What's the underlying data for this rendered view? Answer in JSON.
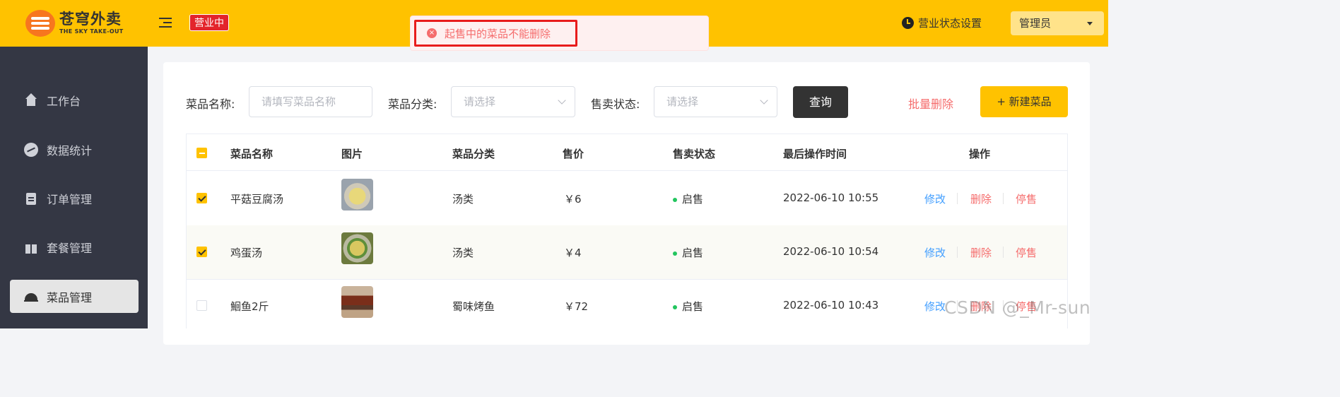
{
  "header": {
    "logo_cn": "苍穹外卖",
    "logo_en": "THE SKY TAKE-OUT",
    "status_tag": "营业中",
    "settings_label": "营业状态设置",
    "admin_label": "管理员"
  },
  "toast": {
    "message": "起售中的菜品不能删除",
    "icon": "error-icon"
  },
  "sidebar": {
    "items": [
      {
        "label": "工作台",
        "icon": "home-icon"
      },
      {
        "label": "数据统计",
        "icon": "chart-icon"
      },
      {
        "label": "订单管理",
        "icon": "clipboard-icon"
      },
      {
        "label": "套餐管理",
        "icon": "gift-icon"
      },
      {
        "label": "菜品管理",
        "icon": "cloche-icon",
        "active": true
      }
    ]
  },
  "filters": {
    "name_label": "菜品名称:",
    "name_placeholder": "请填写菜品名称",
    "category_label": "菜品分类:",
    "category_placeholder": "请选择",
    "status_label": "售卖状态:",
    "status_placeholder": "请选择",
    "query_button": "查询",
    "batch_delete": "批量删除",
    "new_button": "+ 新建菜品"
  },
  "table": {
    "columns": [
      "菜品名称",
      "图片",
      "菜品分类",
      "售价",
      "售卖状态",
      "最后操作时间",
      "操作"
    ],
    "rows": [
      {
        "checked": true,
        "name": "平菇豆腐汤",
        "category": "汤类",
        "price": "￥6",
        "status": "启售",
        "time": "2022-06-10 10:55",
        "edit": "修改",
        "delete": "删除",
        "stop": "停售"
      },
      {
        "checked": true,
        "name": "鸡蛋汤",
        "category": "汤类",
        "price": "￥4",
        "status": "启售",
        "time": "2022-06-10 10:54",
        "edit": "修改",
        "delete": "删除",
        "stop": "停售"
      },
      {
        "checked": false,
        "name": "鮰鱼2斤",
        "category": "蜀味烤鱼",
        "price": "￥72",
        "status": "启售",
        "time": "2022-06-10 10:43",
        "edit": "修改",
        "delete": "删除",
        "stop": "停售"
      }
    ]
  },
  "watermark": "CSDN @_Mr-sun",
  "colors": {
    "brand_yellow": "#ffc200",
    "sidebar_bg": "#343744",
    "danger": "#f56c6c",
    "link_blue": "#419eff",
    "status_green": "#22c55e"
  }
}
